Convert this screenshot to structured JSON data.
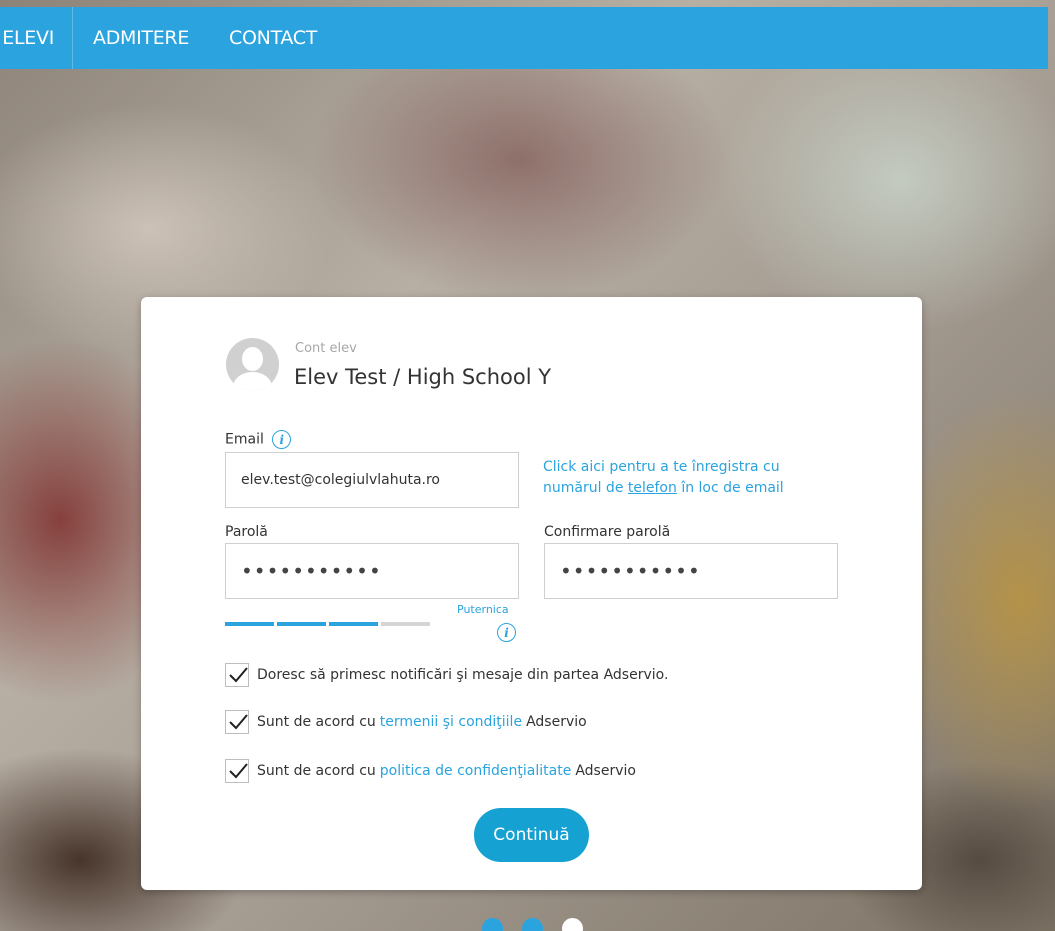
{
  "nav": {
    "items": [
      {
        "label": "ELEVI"
      },
      {
        "label": "ADMITERE"
      },
      {
        "label": "CONTACT"
      }
    ]
  },
  "account": {
    "type_label": "Cont elev",
    "title": "Elev Test / High School Y"
  },
  "form": {
    "email_label": "Email",
    "email_value": "elev.test@colegiulvlahuta.ro",
    "phone_link_prefix": "Click aici pentru a te înregistra cu numărul de ",
    "phone_link_word": "telefon",
    "phone_link_suffix": " în loc de email",
    "password_label": "Parolă",
    "password_value": "•••••••••••",
    "confirm_label": "Confirmare parolă",
    "confirm_value": "•••••••••••",
    "strength_label": "Puternica",
    "strength_level": 3,
    "strength_max": 4,
    "checkbox_notifications": "Doresc să primesc notificări şi mesaje din partea Adservio.",
    "checkbox_terms_prefix": "Sunt de acord cu",
    "checkbox_terms_link": "termenii şi condiţiile",
    "checkbox_terms_suffix": "Adservio",
    "checkbox_privacy_prefix": "Sunt de acord cu",
    "checkbox_privacy_link": "politica de confidenţialitate",
    "checkbox_privacy_suffix": "Adservio",
    "submit_label": "Continuă"
  },
  "info_icon_glyph": "i",
  "colors": {
    "accent": "#2aa3de",
    "button": "#15a1d2"
  },
  "pager": {
    "count": 3,
    "active_index": 2
  }
}
